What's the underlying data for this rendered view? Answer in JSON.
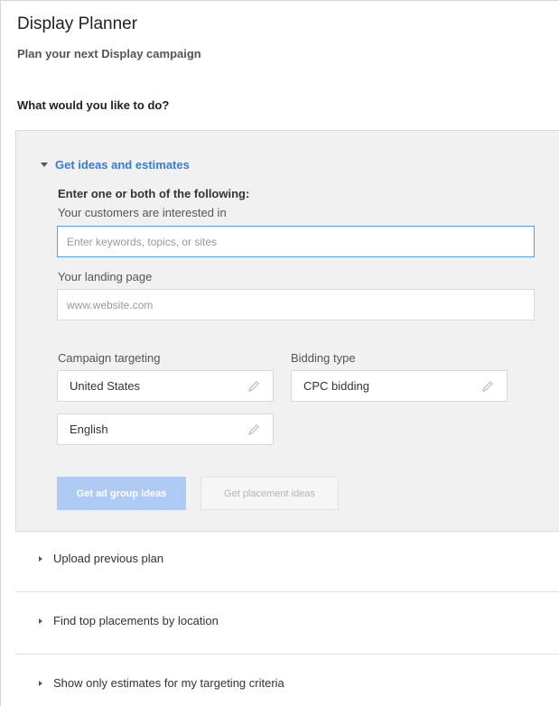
{
  "header": {
    "title": "Display Planner",
    "subtitle": "Plan your next Display campaign",
    "question": "What would you like to do?"
  },
  "ideas_section": {
    "heading": "Get ideas and estimates",
    "instruction": "Enter one or both of the following:",
    "interests_label": "Your customers are interested in",
    "interests_placeholder": "Enter keywords, topics, or sites",
    "landing_label": "Your landing page",
    "landing_placeholder": "www.website.com",
    "targeting_label": "Campaign targeting",
    "location_value": "United States",
    "language_value": "English",
    "bidding_label": "Bidding type",
    "bidding_value": "CPC bidding",
    "primary_button": "Get ad group ideas",
    "secondary_button": "Get placement ideas"
  },
  "other_options": [
    "Upload previous plan",
    "Find top placements by location",
    "Show only estimates for my targeting criteria"
  ],
  "colors": {
    "link": "#3a7bd5",
    "panel_bg": "#f1f1f1",
    "primary_button_bg": "#aecbf5",
    "focus_border": "#5b9cf0"
  },
  "icons": {
    "expand": "caret-down-icon",
    "collapsed": "caret-right-icon",
    "edit": "pencil-icon"
  }
}
